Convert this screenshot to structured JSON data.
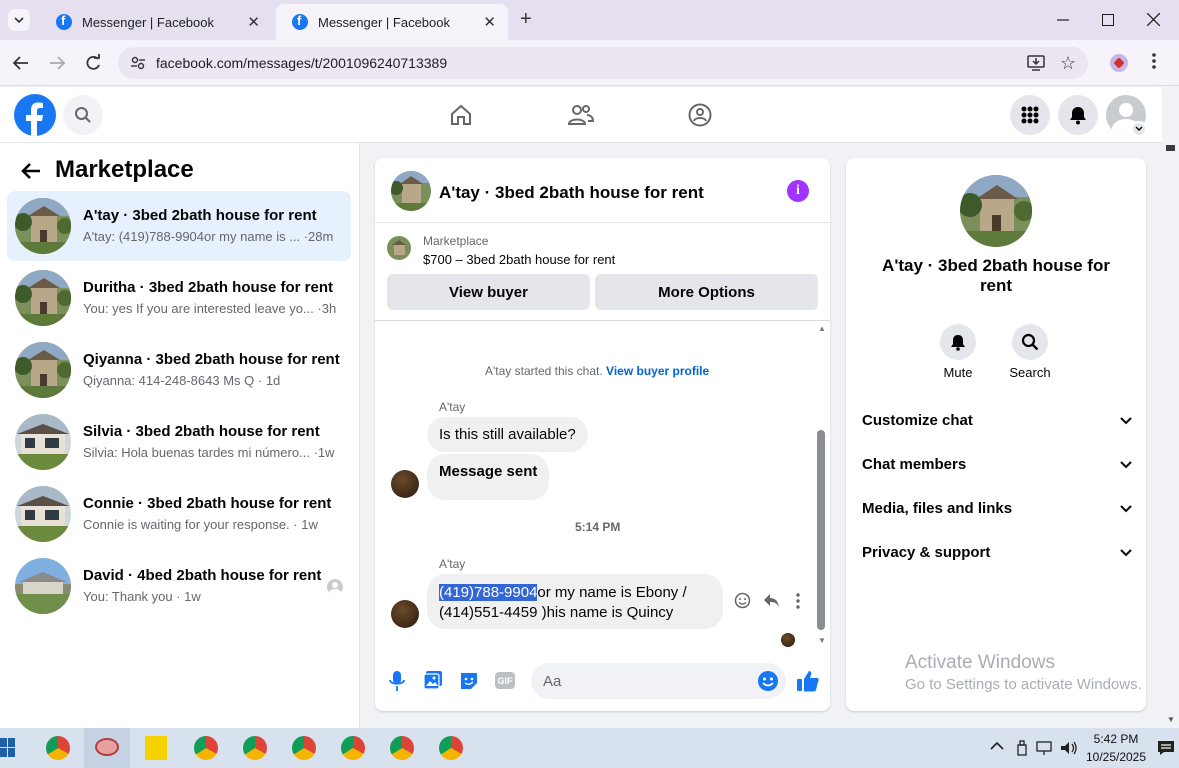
{
  "browser": {
    "tabs": [
      {
        "title": "Messenger | Facebook"
      },
      {
        "title": "Messenger | Facebook"
      }
    ],
    "url": "facebook.com/messages/t/2001096240713389",
    "window_controls": [
      "minimize-icon",
      "maximize-icon",
      "close-icon"
    ]
  },
  "sidebar": {
    "heading": "Marketplace",
    "conversations": [
      {
        "title": "A'tay · 3bed 2bath house for rent",
        "preview": "A'tay: (419)788-9904or my name is ... ·28m"
      },
      {
        "title": "Duritha · 3bed 2bath house for rent",
        "preview": "You: yes If you are interested leave yo... ·3h"
      },
      {
        "title": "Qiyanna · 3bed 2bath house for rent",
        "preview": "Qiyanna: 414-248-8643 Ms Q · 1d"
      },
      {
        "title": "Silvia · 3bed 2bath house for rent",
        "preview": "Silvia: Hola buenas tardes mi número... ·1w"
      },
      {
        "title": "Connie · 3bed 2bath house for rent",
        "preview": "Connie is waiting for your response. · 1w"
      },
      {
        "title": "David · 4bed 2bath house for rent",
        "preview": "You: Thank you · 1w"
      }
    ]
  },
  "chat": {
    "title": "A'tay · 3bed 2bath house for rent",
    "listing_label": "Marketplace",
    "listing_detail": "$700 – 3bed 2bath house for rent",
    "view_buyer": "View buyer",
    "more_options": "More Options",
    "started_text": "A'tay started this chat.",
    "view_profile": "View buyer profile",
    "sender1": "A'tay",
    "msg1": "Is this still available?",
    "msg2": "Message sent",
    "time": "5:14 PM",
    "sender2": "A'tay",
    "msg3_highlight": "(419)788-9904",
    "msg3_line1": "or my name is Ebony /",
    "msg3_line2": "(414)551-4459 )his name is Quincy",
    "composer_placeholder": "Aa"
  },
  "info": {
    "name": "A'tay · 3bed 2bath house for rent",
    "mute": "Mute",
    "search": "Search",
    "sections": [
      "Customize chat",
      "Chat members",
      "Media, files and links",
      "Privacy & support"
    ],
    "watermark_title": "Activate Windows",
    "watermark_sub": "Go to Settings to activate Windows."
  },
  "taskbar": {
    "time": "5:42 PM",
    "date": "10/25/2025"
  },
  "colors": {
    "fb_blue": "#1877f2",
    "purple_info": "#a033ff",
    "link_blue": "#0064d1"
  }
}
